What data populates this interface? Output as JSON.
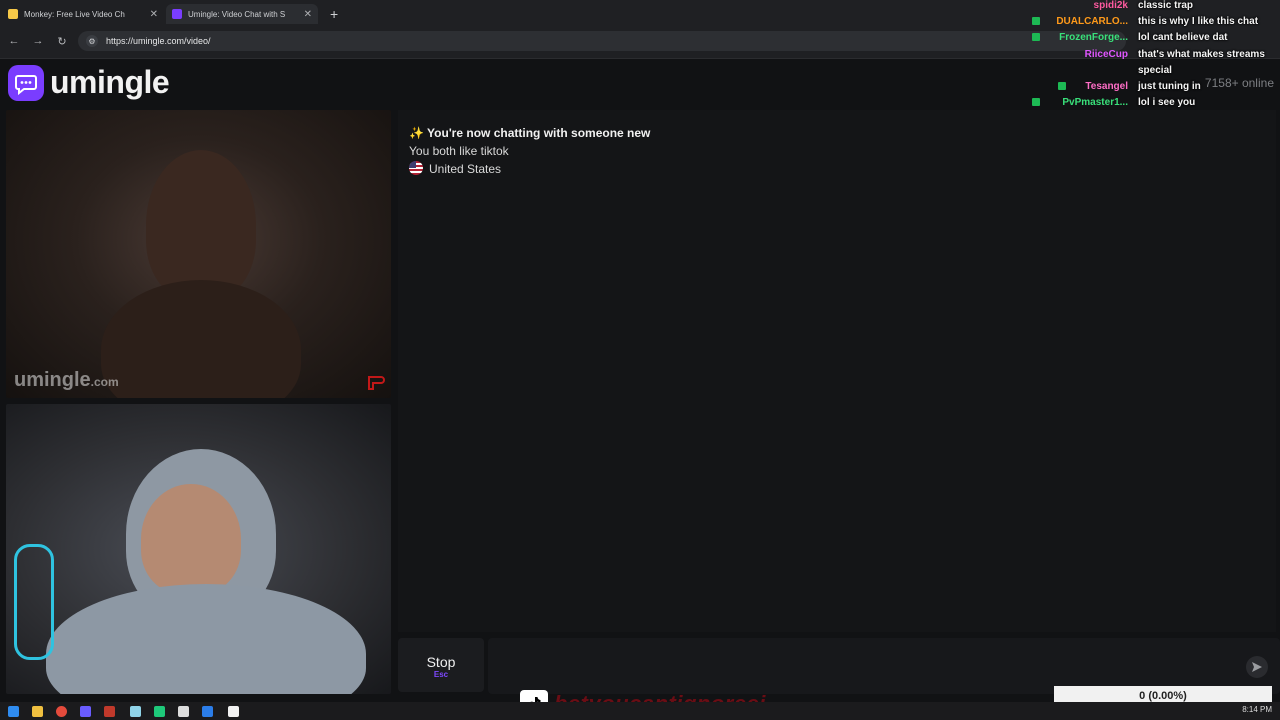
{
  "browser": {
    "tabs": [
      {
        "title": "Monkey: Free Live Video Ch",
        "active": false
      },
      {
        "title": "Umingle: Video Chat with S",
        "active": true
      }
    ],
    "url": "https://umingle.com/video/"
  },
  "site": {
    "logo_text": "umingle",
    "online_count": "7158+ online",
    "watermark": "umingle",
    "watermark_suffix": ".com"
  },
  "chat": {
    "system_message": "✨ You're now chatting with someone new",
    "shared_interest": "You both like tiktok",
    "country": "United States"
  },
  "controls": {
    "stop_label": "Stop",
    "stop_shortcut": "Esc"
  },
  "stream_overlay": {
    "messages": [
      {
        "user": "spidi2k",
        "text": "classic trap",
        "color": "#ff5aa0"
      },
      {
        "user": "DUALCARLO...",
        "text": "this is why I like this chat",
        "color": "#ff9a1a"
      },
      {
        "user": "FrozenForge...",
        "text": "lol cant believe dat",
        "color": "#39e07a"
      },
      {
        "user": "RiiceCup",
        "text": "that's what makes streams",
        "color": "#e056ff"
      },
      {
        "user": "",
        "text": "special",
        "color": "#ffffff"
      },
      {
        "user": "Tesangel",
        "text": "just tuning in",
        "color": "#ff6ec7"
      },
      {
        "user": "PvPmaster1...",
        "text": "lol i see you",
        "color": "#39e07a"
      }
    ],
    "tiktok_handle": "betyoucantignoreej",
    "goal_text": "0 (0.00%)"
  },
  "taskbar": {
    "clock": "8:14 PM"
  }
}
